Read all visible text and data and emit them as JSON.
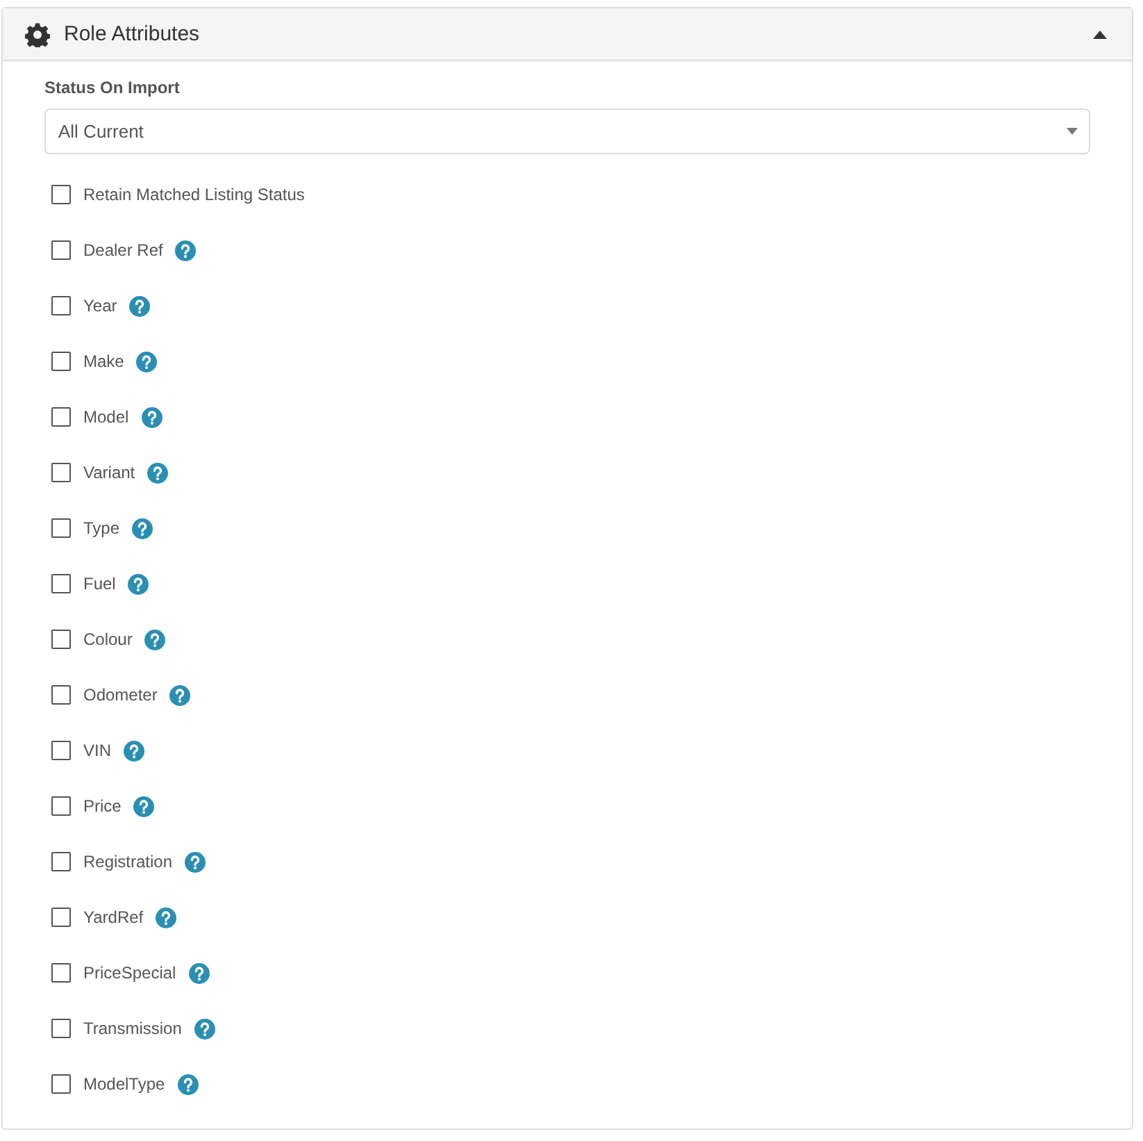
{
  "panel": {
    "title": "Role Attributes",
    "expanded": true
  },
  "status_field": {
    "label": "Status On Import",
    "value": "All Current"
  },
  "options": [
    {
      "label": "Retain Matched Listing Status",
      "checked": false,
      "help": false
    },
    {
      "label": "Dealer Ref",
      "checked": false,
      "help": true
    },
    {
      "label": "Year",
      "checked": false,
      "help": true
    },
    {
      "label": "Make",
      "checked": false,
      "help": true
    },
    {
      "label": "Model",
      "checked": false,
      "help": true
    },
    {
      "label": "Variant",
      "checked": false,
      "help": true
    },
    {
      "label": "Type",
      "checked": false,
      "help": true
    },
    {
      "label": "Fuel",
      "checked": false,
      "help": true
    },
    {
      "label": "Colour",
      "checked": false,
      "help": true
    },
    {
      "label": "Odometer",
      "checked": false,
      "help": true
    },
    {
      "label": "VIN",
      "checked": false,
      "help": true
    },
    {
      "label": "Price",
      "checked": false,
      "help": true
    },
    {
      "label": "Registration",
      "checked": false,
      "help": true
    },
    {
      "label": "YardRef",
      "checked": false,
      "help": true
    },
    {
      "label": "PriceSpecial",
      "checked": false,
      "help": true
    },
    {
      "label": "Transmission",
      "checked": false,
      "help": true
    },
    {
      "label": "ModelType",
      "checked": false,
      "help": true
    }
  ]
}
